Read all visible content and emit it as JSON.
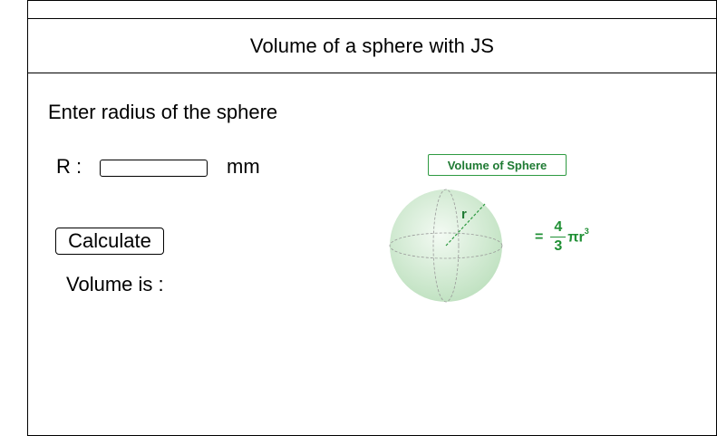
{
  "header": {
    "title": "Volume of a sphere with JS"
  },
  "form": {
    "prompt": "Enter radius of the sphere",
    "radius_label": "R :",
    "radius_value": "",
    "radius_placeholder": "",
    "unit": "mm",
    "calculate_label": "Calculate",
    "result_label": "Volume is :",
    "result_value": ""
  },
  "illustration": {
    "title": "Volume of Sphere",
    "radius_symbol": "r",
    "formula": {
      "equals": "=",
      "numerator": "4",
      "denominator": "3",
      "tail": "πr",
      "exponent": "3"
    },
    "colors": {
      "accent": "#2e9a41",
      "sphere_light": "#eaf6ea",
      "sphere_dark": "#bfe3c1"
    }
  }
}
